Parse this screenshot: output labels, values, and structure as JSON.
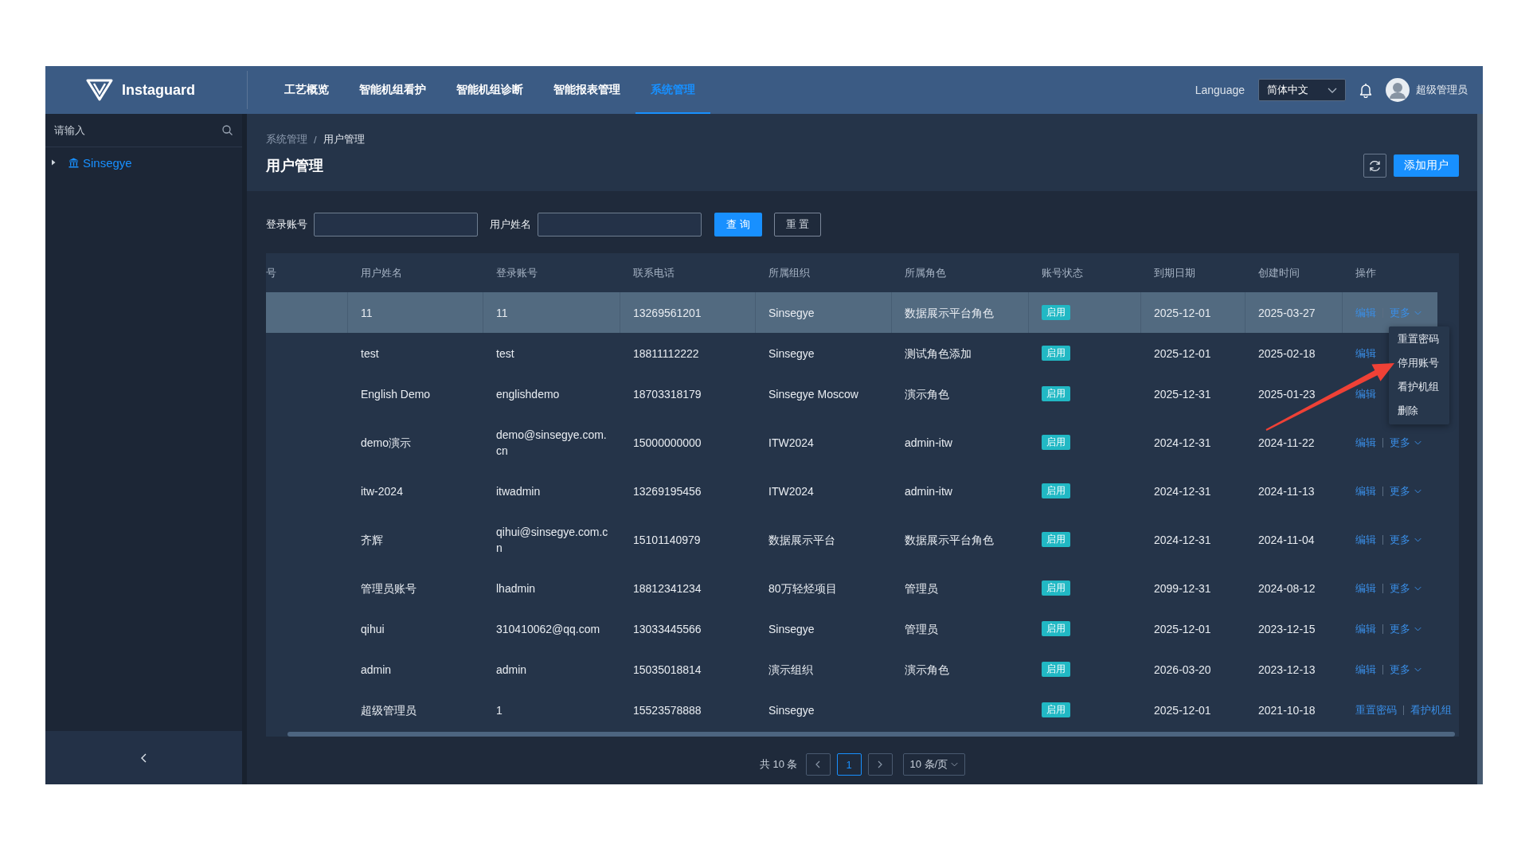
{
  "topbar": {
    "brand": "Instaguard",
    "nav": [
      {
        "label": "工艺概览",
        "selected": false
      },
      {
        "label": "智能机组看护",
        "selected": false
      },
      {
        "label": "智能机组诊断",
        "selected": false
      },
      {
        "label": "智能报表管理",
        "selected": false
      },
      {
        "label": "系统管理",
        "selected": true
      }
    ],
    "language_label": "Language",
    "language_select": "简体中文",
    "user_name": "超级管理员"
  },
  "sidebar": {
    "search": {
      "placeholder": "请输入"
    },
    "tree": [
      {
        "label": "Sinsegye",
        "expanded": false
      }
    ]
  },
  "header": {
    "breadcrumb": {
      "items": [
        "系统管理",
        "用户管理"
      ],
      "separator": "/"
    },
    "title": "用户管理",
    "add_button": "添加用户"
  },
  "filters": {
    "fields": [
      {
        "label": "登录账号"
      },
      {
        "label": "用户姓名"
      }
    ],
    "search_button": "查 询",
    "reset_button": "重 置"
  },
  "table": {
    "columns": [
      "号",
      "用户姓名",
      "登录账号",
      "联系电话",
      "所属组织",
      "所属角色",
      "账号状态",
      "到期日期",
      "创建时间",
      "操作"
    ],
    "rows": [
      {
        "highlighted": true,
        "name": "11",
        "account": "11",
        "phone": "13269561201",
        "org": "Sinsegye",
        "role": "数据展示平台角色",
        "status": "启用",
        "expires": "2025-12-01",
        "created": "2025-03-27",
        "actions": [
          {
            "label": "编辑",
            "kind": "link"
          },
          {
            "label": "更多",
            "kind": "menu"
          }
        ]
      },
      {
        "highlighted": false,
        "name": "test",
        "account": "test",
        "phone": "18811112222",
        "org": "Sinsegye",
        "role": "测试角色添加",
        "status": "启用",
        "expires": "2025-12-01",
        "created": "2025-02-18",
        "actions": [
          {
            "label": "编辑",
            "kind": "link"
          }
        ]
      },
      {
        "highlighted": false,
        "name": "English Demo",
        "account": "englishdemo",
        "phone": "18703318179",
        "org": "Sinsegye Moscow",
        "role": "演示角色",
        "status": "启用",
        "expires": "2025-12-31",
        "created": "2025-01-23",
        "actions": [
          {
            "label": "编辑",
            "kind": "link"
          }
        ]
      },
      {
        "highlighted": false,
        "name": "demo演示",
        "account": "demo@sinsegye.com.cn",
        "phone": "15000000000",
        "org": "ITW2024",
        "role": "admin-itw",
        "status": "启用",
        "expires": "2024-12-31",
        "created": "2024-11-22",
        "actions": [
          {
            "label": "编辑",
            "kind": "link"
          },
          {
            "label": "更多",
            "kind": "menu"
          }
        ]
      },
      {
        "highlighted": false,
        "name": "itw-2024",
        "account": "itwadmin",
        "phone": "13269195456",
        "org": "ITW2024",
        "role": "admin-itw",
        "status": "启用",
        "expires": "2024-12-31",
        "created": "2024-11-13",
        "actions": [
          {
            "label": "编辑",
            "kind": "link"
          },
          {
            "label": "更多",
            "kind": "menu"
          }
        ]
      },
      {
        "highlighted": false,
        "name": "齐辉",
        "account": "qihui@sinsegye.com.cn",
        "phone": "15101140979",
        "org": "数据展示平台",
        "role": "数据展示平台角色",
        "status": "启用",
        "expires": "2024-12-31",
        "created": "2024-11-04",
        "actions": [
          {
            "label": "编辑",
            "kind": "link"
          },
          {
            "label": "更多",
            "kind": "menu"
          }
        ]
      },
      {
        "highlighted": false,
        "name": "管理员账号",
        "account": "lhadmin",
        "phone": "18812341234",
        "org": "80万轻烃项目",
        "role": "管理员",
        "status": "启用",
        "expires": "2099-12-31",
        "created": "2024-08-12",
        "actions": [
          {
            "label": "编辑",
            "kind": "link"
          },
          {
            "label": "更多",
            "kind": "menu"
          }
        ]
      },
      {
        "highlighted": false,
        "name": "qihui",
        "account": "310410062@qq.com",
        "phone": "13033445566",
        "org": "Sinsegye",
        "role": "管理员",
        "status": "启用",
        "expires": "2025-12-01",
        "created": "2023-12-15",
        "actions": [
          {
            "label": "编辑",
            "kind": "link"
          },
          {
            "label": "更多",
            "kind": "menu"
          }
        ]
      },
      {
        "highlighted": false,
        "name": "admin",
        "account": "admin",
        "phone": "15035018814",
        "org": "演示组织",
        "role": "演示角色",
        "status": "启用",
        "expires": "2026-03-20",
        "created": "2023-12-13",
        "actions": [
          {
            "label": "编辑",
            "kind": "link"
          },
          {
            "label": "更多",
            "kind": "menu"
          }
        ]
      },
      {
        "highlighted": false,
        "name": "超级管理员",
        "account": "1",
        "phone": "15523578888",
        "org": "Sinsegye",
        "status": "启用",
        "expires": "2025-12-01",
        "created": "2021-10-18",
        "actions": [
          {
            "label": "重置密码",
            "kind": "link"
          },
          {
            "label": "看护机组",
            "kind": "link"
          }
        ]
      }
    ],
    "dropdown_menu": {
      "items": [
        "重置密码",
        "停用账号",
        "看护机组",
        "删除"
      ]
    }
  },
  "pagination": {
    "total": "共 10 条",
    "pages": [
      {
        "label": "1",
        "selected": true
      }
    ],
    "page_size": "10 条/页"
  }
}
